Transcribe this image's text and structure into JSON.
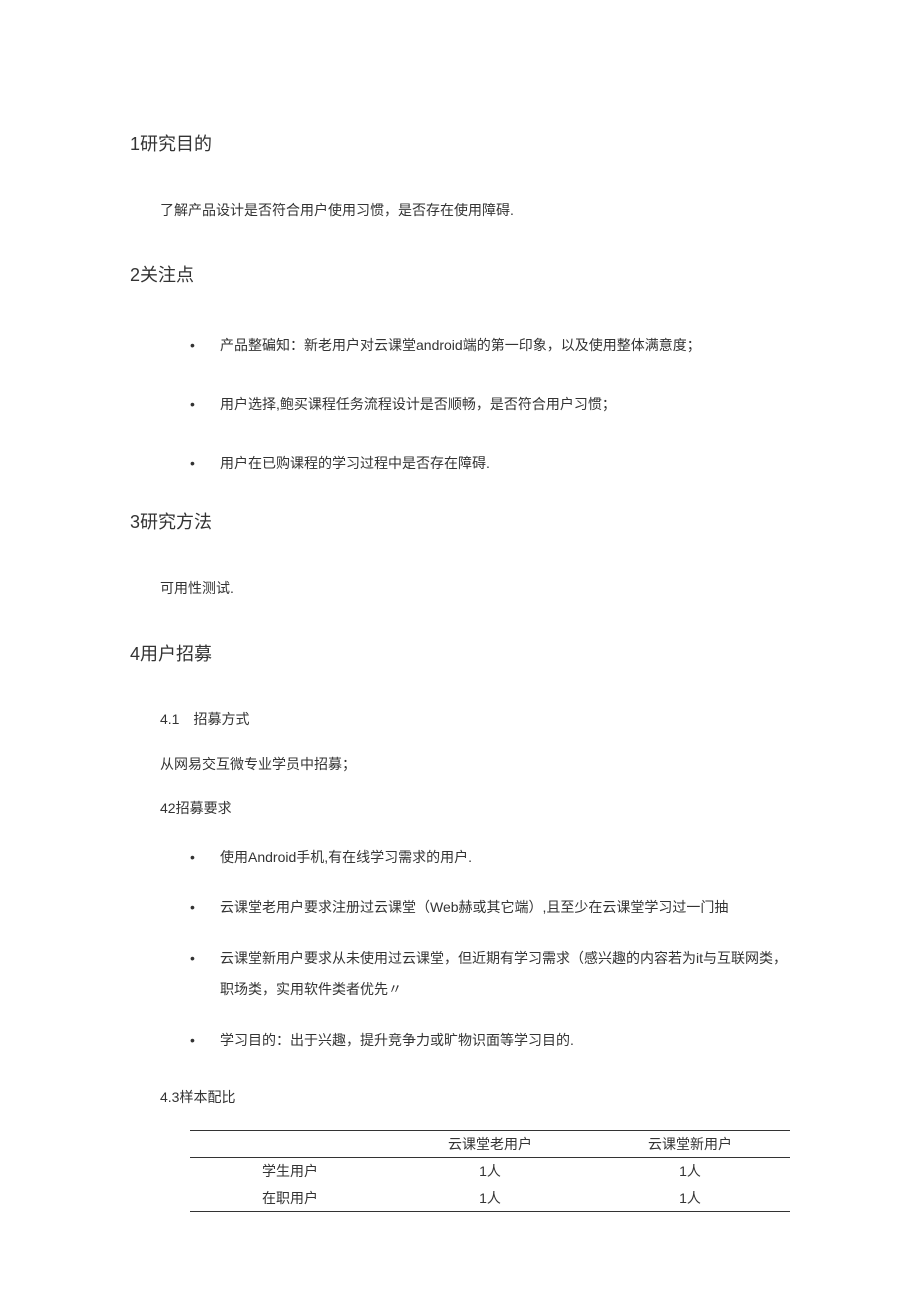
{
  "sections": {
    "s1": {
      "heading": "1研究目的",
      "para": "了解产品设计是否符合用户使用习惯，是否存在使用障碍."
    },
    "s2": {
      "heading": "2关注点",
      "bullets": [
        "产品整碥知：新老用户对云课堂android端的第一印象，以及使用整体满意度；",
        "用户选择,鲍买课程任务流程设计是否顺畅，是否符合用户习惯；",
        "用户在已购课程的学习过程中是否存在障碍."
      ]
    },
    "s3": {
      "heading": "3研究方法",
      "para": "可用性测试."
    },
    "s4": {
      "heading": "4用户招募",
      "sub41_heading": "4.1　招募方式",
      "sub41_para": "从网易交互微专业学员中招募；",
      "sub42_heading": "42招募要求",
      "sub42_bullets": [
        "使用Android手机,有在线学习需求的用户.",
        "云课堂老用户要求注册过云课堂（Web赫或其它端）,且至少在云课堂学习过一门抽",
        "云课堂新用户要求从未使用过云课堂，但近期有学习需求（感兴趣的内容若为it与互联网类，职场类，实用软件类者优先〃",
        "学习目的：出于兴趣，提升竞争力或旷物识面等学习目的."
      ],
      "sub43_heading": "4.3样本配比",
      "table": {
        "headers": [
          "",
          "云课堂老用户",
          "云课堂新用户"
        ],
        "rows": [
          [
            "学生用户",
            "1人",
            "1人"
          ],
          [
            "在职用户",
            "1人",
            "1人"
          ]
        ]
      }
    }
  }
}
